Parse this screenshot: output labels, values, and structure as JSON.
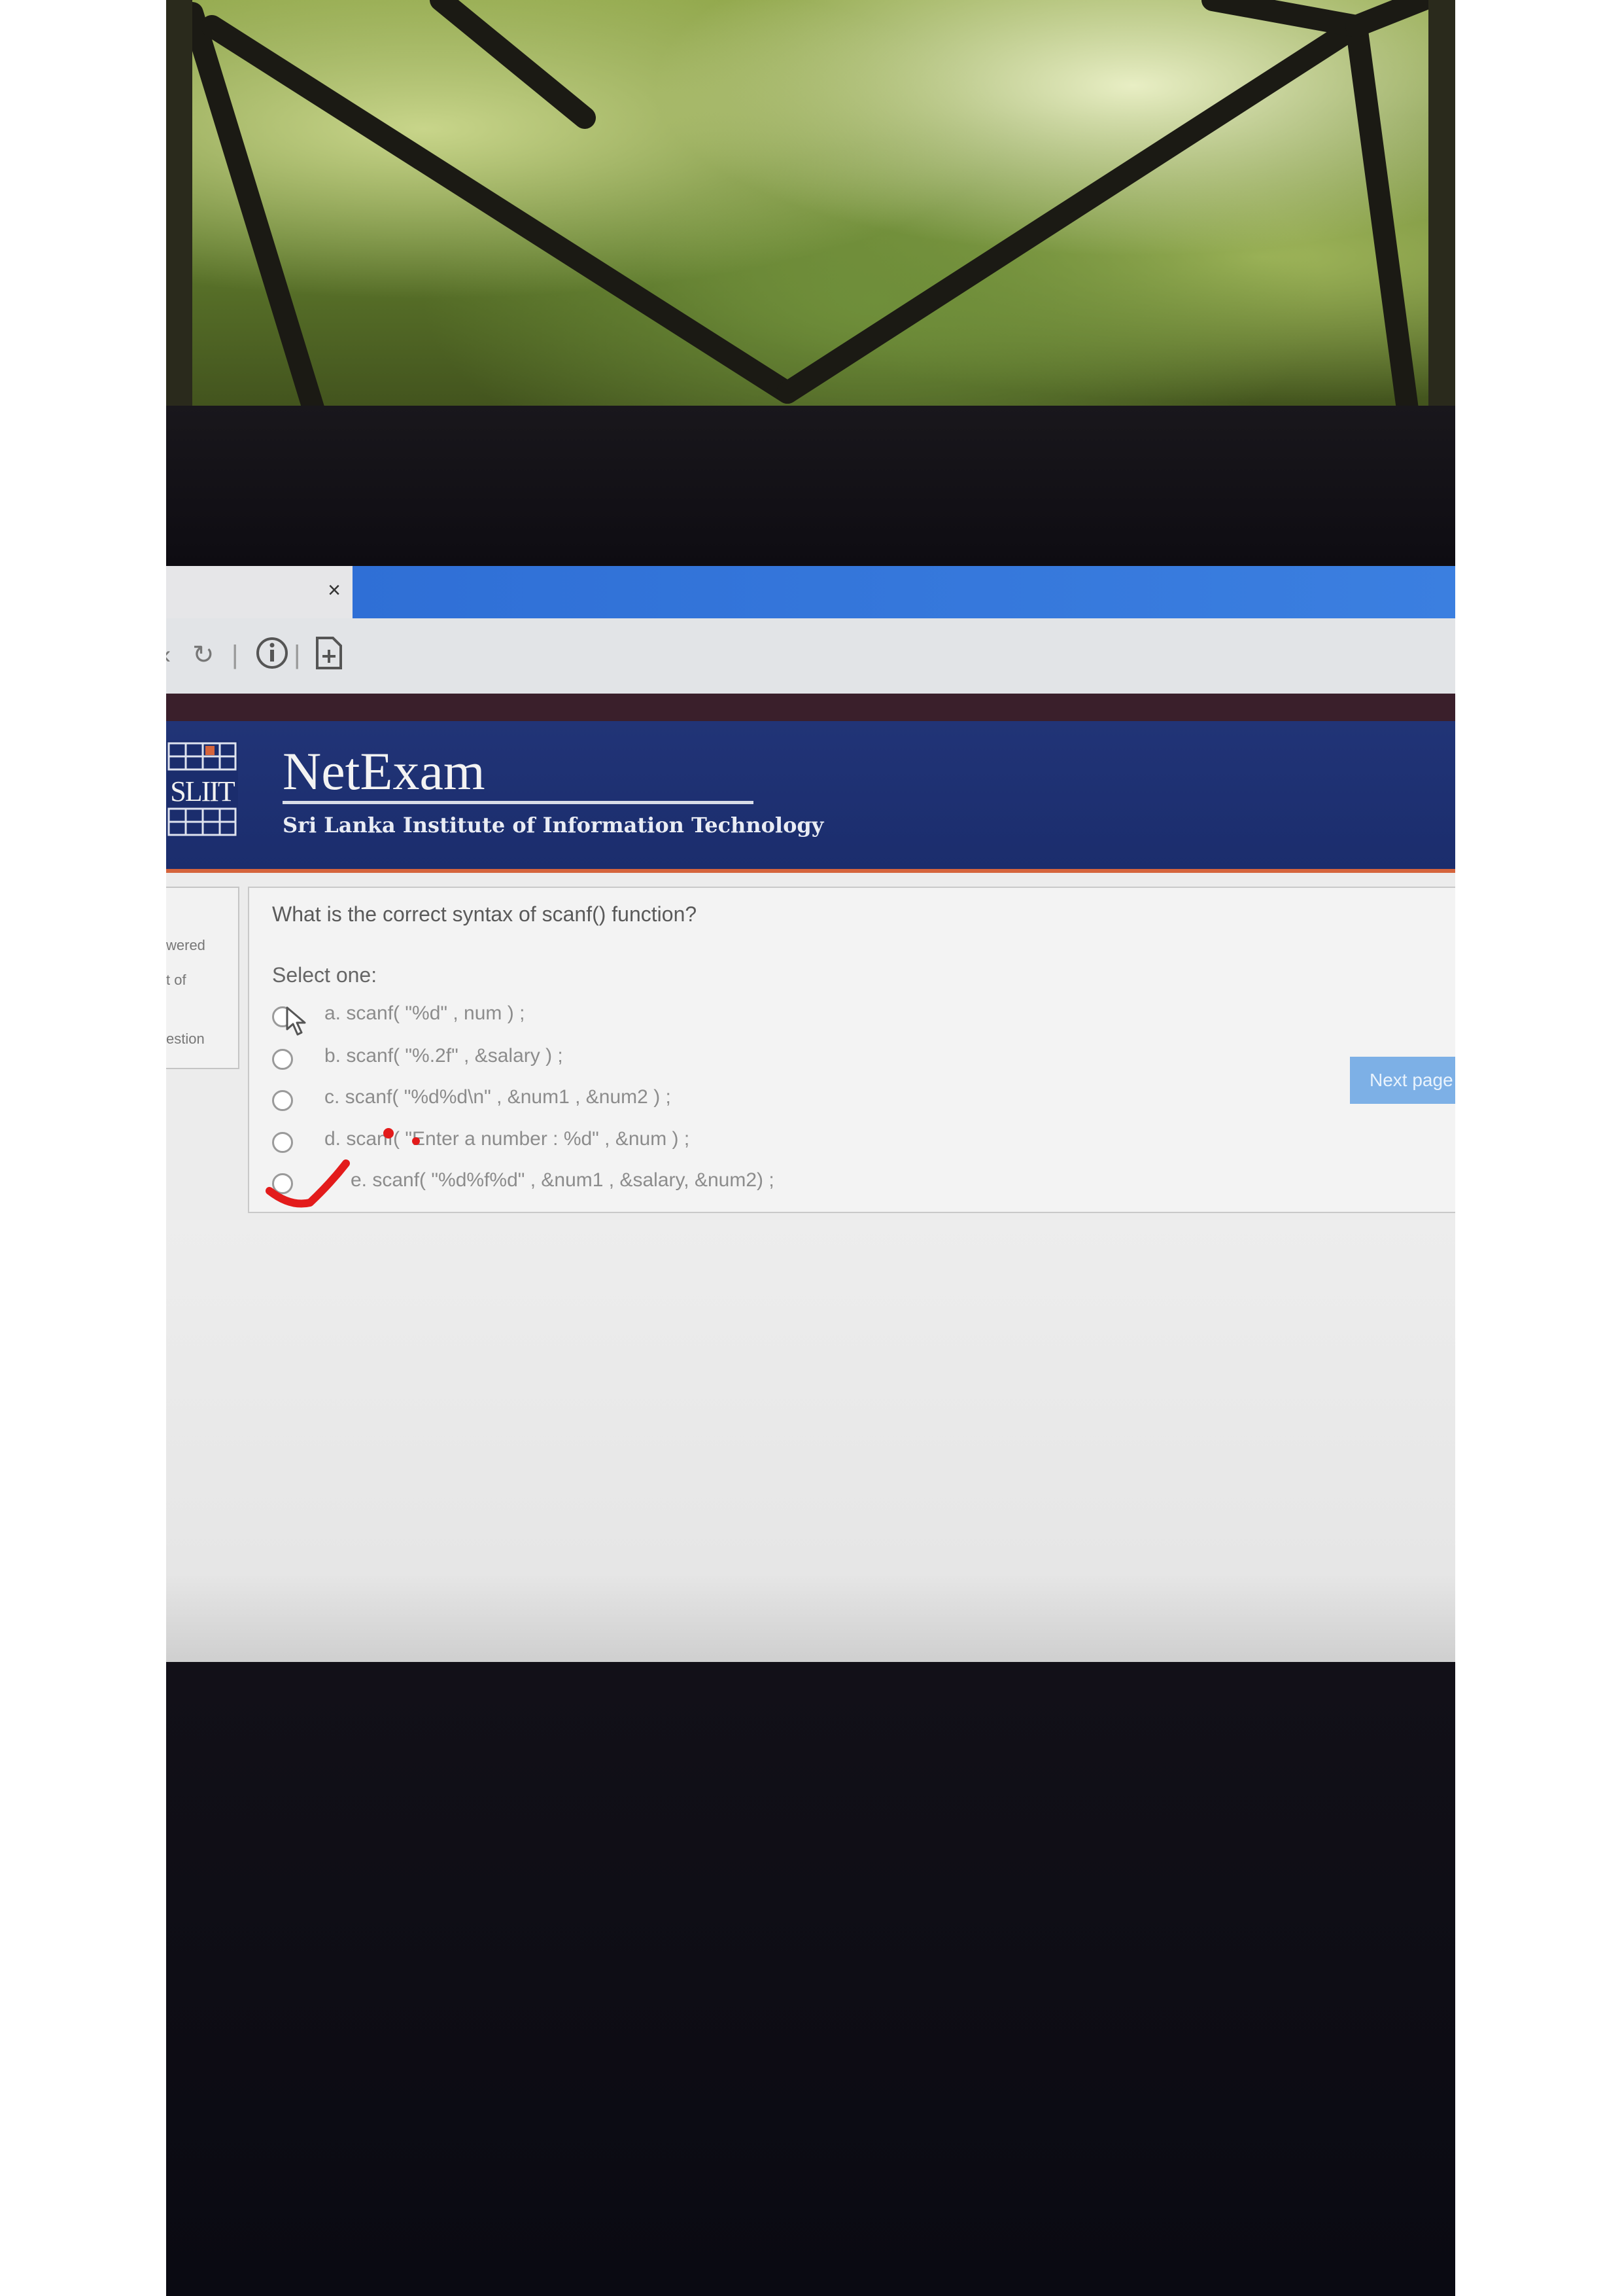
{
  "browser": {
    "tab_close": "×",
    "nav_back_icon": "chevron-left-icon",
    "nav_reload_icon": "reload-icon",
    "info_icon": "info-icon",
    "page_icon": "new-page-icon"
  },
  "header": {
    "logo_text": "SLIIT",
    "title": "NetExam",
    "subtitle": "Sri Lanka Institute of Information Technology"
  },
  "sidebar": {
    "line1": "wered",
    "line2": "t of",
    "line3": "estion"
  },
  "question": {
    "text": "What is the correct syntax of scanf() function?",
    "select_label": "Select one:",
    "options": [
      {
        "label": "a. scanf( \"%d\" , num ) ;"
      },
      {
        "label": "b. scanf( \"%.2f\" , &salary ) ;"
      },
      {
        "label": "c. scanf( \"%d%d\\n\" , &num1 , &num2 ) ;"
      },
      {
        "label": "d. scanf( \"Enter a number : %d\" , &num ) ;"
      },
      {
        "label": "e. scanf( \"%d%f%d\" , &num1 , &salary, &num2) ;"
      }
    ]
  },
  "next_button": "Next page",
  "colors": {
    "header_bg": "#1b2d6d",
    "header_accent": "#d5643c",
    "next_button_bg": "#7db0e6",
    "annotation_red": "#e31b1b"
  }
}
